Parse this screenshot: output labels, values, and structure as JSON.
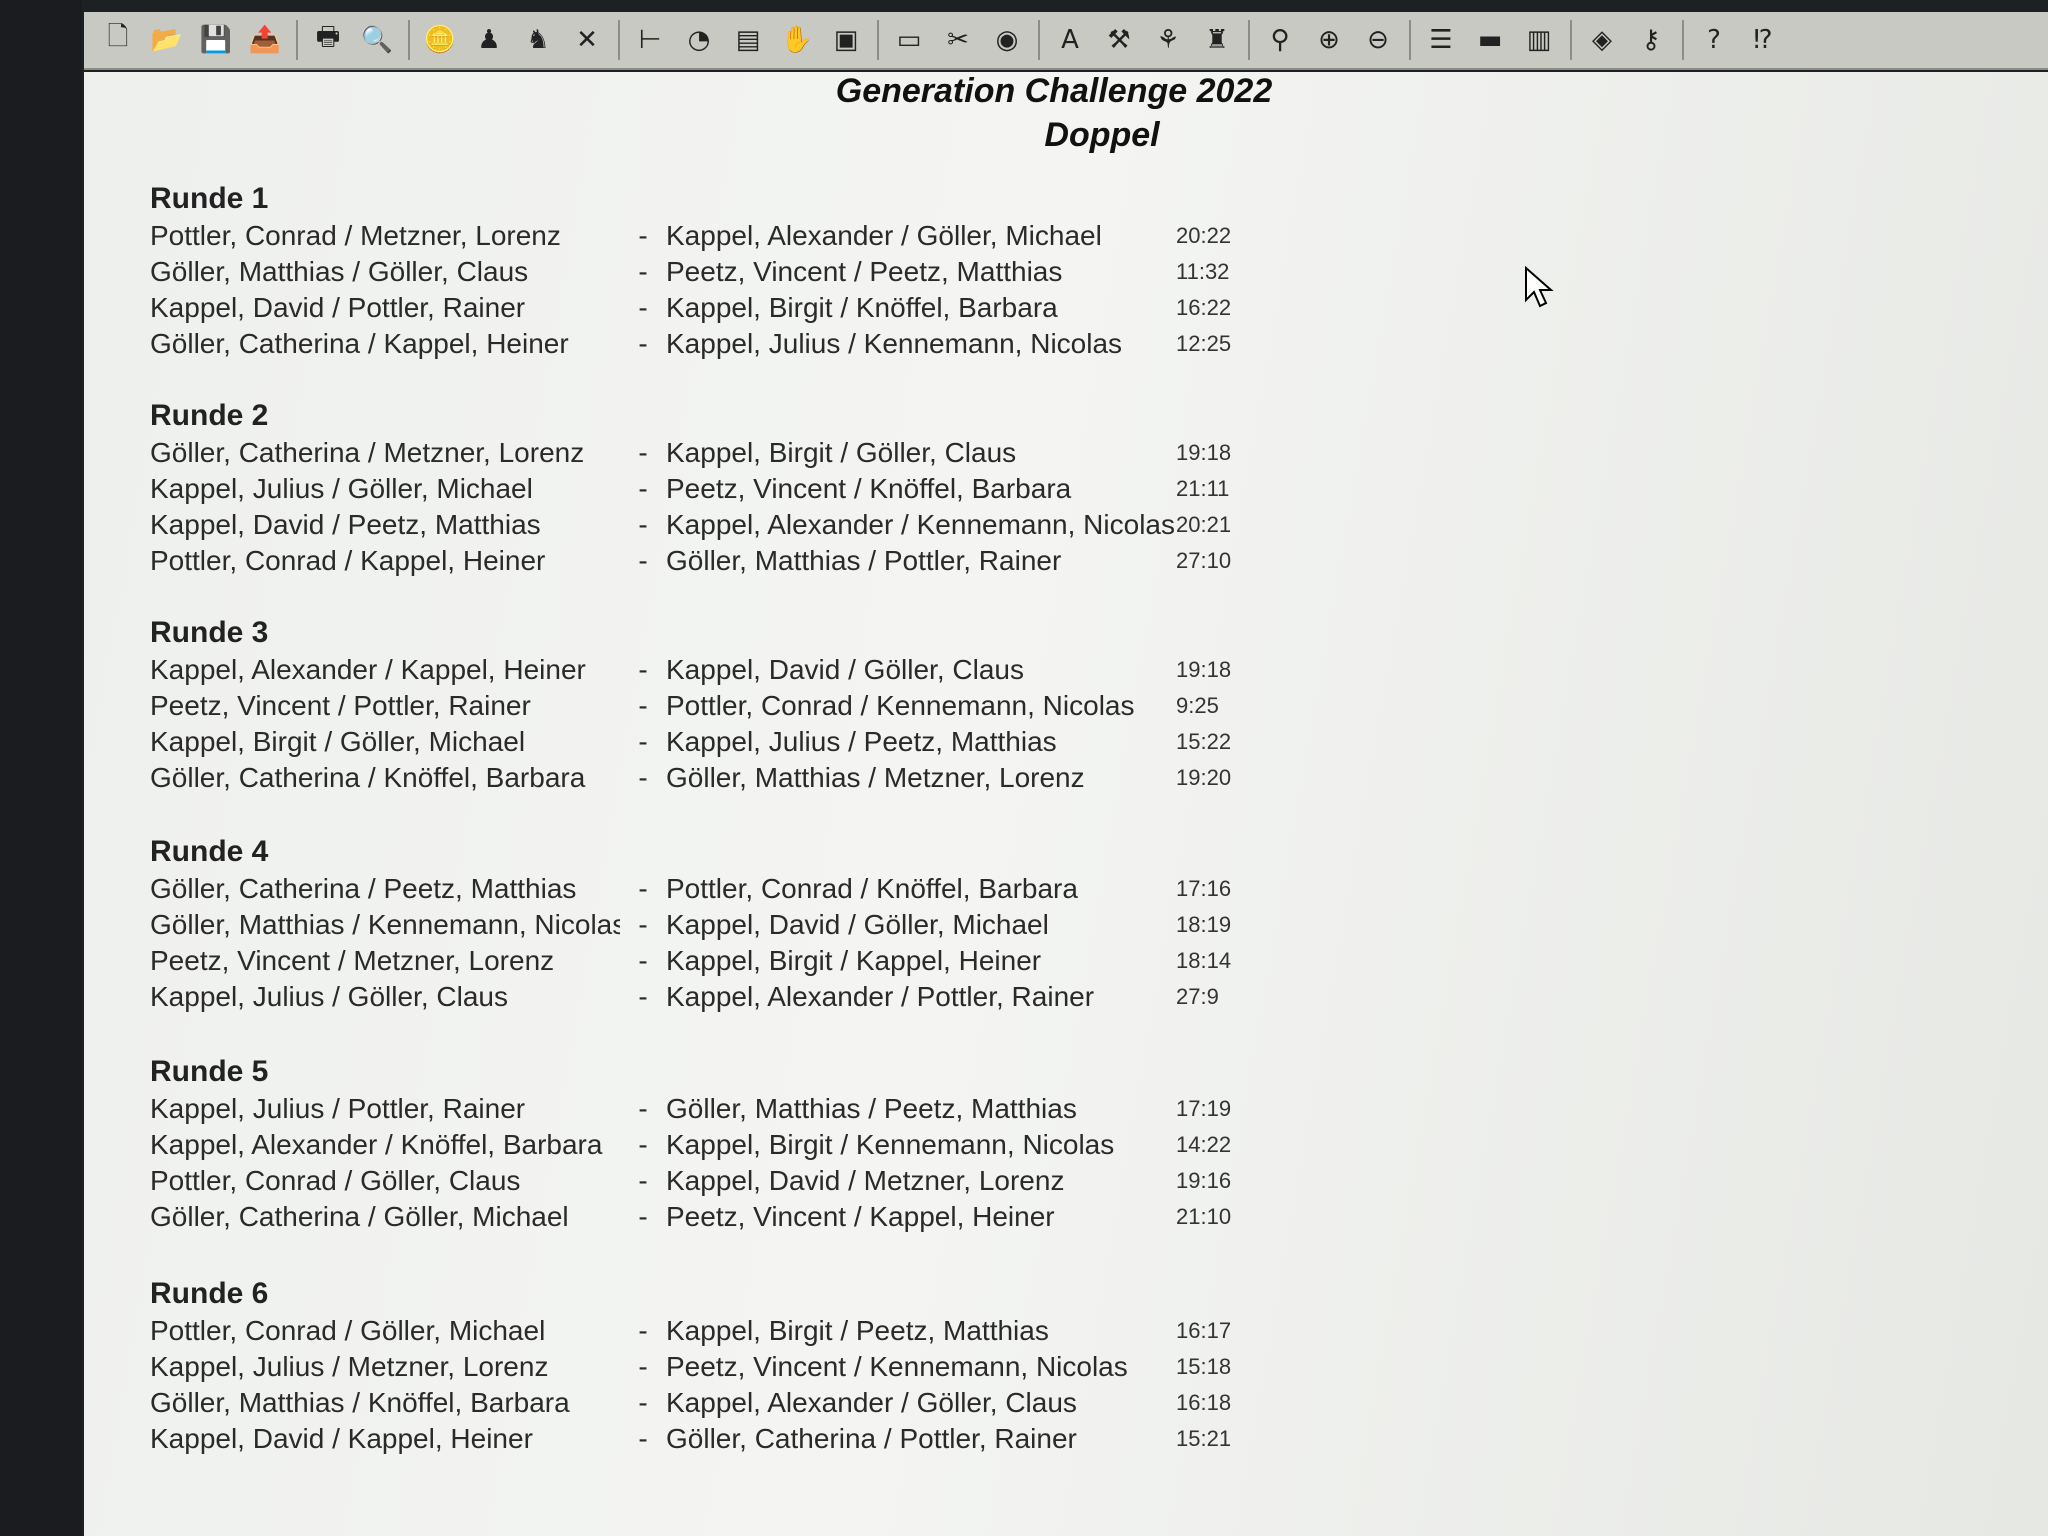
{
  "toolbar": {
    "icons": [
      "new-document-icon",
      "open-folder-icon",
      "save-icon",
      "export-icon",
      "print-icon",
      "print-preview-icon",
      "coin-icon",
      "person-icon",
      "add-person-icon",
      "delete-icon",
      "tree-icon",
      "clock-icon",
      "list-icon",
      "hand-icon",
      "box-icon",
      "card-icon",
      "scissor-icon",
      "globe-icon",
      "text-icon",
      "tools-icon",
      "star-person-icon",
      "group-icon",
      "search-icon",
      "zoom-in-icon",
      "zoom-out-icon",
      "layers-icon",
      "rows-icon",
      "columns-icon",
      "badge-icon",
      "key-icon",
      "help-icon",
      "context-help-icon"
    ],
    "glyphs": [
      "🗋",
      "📂",
      "💾",
      "📤",
      "🖶",
      "🔍",
      "🪙",
      "♟",
      "♞",
      "✕",
      "⊢",
      "◔",
      "▤",
      "✋",
      "▣",
      "▭",
      "✂",
      "◉",
      "A",
      "⚒",
      "⚘",
      "♜",
      "⚲",
      "⊕",
      "⊖",
      "☰",
      "▬",
      "▥",
      "◈",
      "⚷",
      "?",
      "⁉"
    ]
  },
  "header": {
    "title": "Generation Challenge 2022",
    "subtitle": "Doppel"
  },
  "rounds": [
    {
      "title": "Runde 1",
      "matches": [
        {
          "team_a": "Pottler, Conrad / Metzner, Lorenz",
          "team_b": "Kappel, Alexander / Göller, Michael",
          "score": "20:22"
        },
        {
          "team_a": "Göller, Matthias / Göller, Claus",
          "team_b": "Peetz, Vincent / Peetz, Matthias",
          "score": "11:32"
        },
        {
          "team_a": "Kappel, David / Pottler, Rainer",
          "team_b": "Kappel, Birgit / Knöffel, Barbara",
          "score": "16:22"
        },
        {
          "team_a": "Göller, Catherina / Kappel, Heiner",
          "team_b": "Kappel, Julius / Kennemann, Nicolas",
          "score": "12:25"
        }
      ]
    },
    {
      "title": "Runde 2",
      "matches": [
        {
          "team_a": "Göller, Catherina / Metzner, Lorenz",
          "team_b": "Kappel, Birgit / Göller, Claus",
          "score": "19:18"
        },
        {
          "team_a": "Kappel, Julius / Göller, Michael",
          "team_b": "Peetz, Vincent / Knöffel, Barbara",
          "score": "21:11"
        },
        {
          "team_a": "Kappel, David / Peetz, Matthias",
          "team_b": "Kappel, Alexander / Kennemann, Nicolas",
          "score": "20:21"
        },
        {
          "team_a": "Pottler, Conrad / Kappel, Heiner",
          "team_b": "Göller, Matthias / Pottler, Rainer",
          "score": "27:10"
        }
      ]
    },
    {
      "title": "Runde 3",
      "matches": [
        {
          "team_a": "Kappel, Alexander / Kappel, Heiner",
          "team_b": "Kappel, David / Göller, Claus",
          "score": "19:18"
        },
        {
          "team_a": "Peetz, Vincent / Pottler, Rainer",
          "team_b": "Pottler, Conrad / Kennemann, Nicolas",
          "score": "9:25"
        },
        {
          "team_a": "Kappel, Birgit / Göller, Michael",
          "team_b": "Kappel, Julius / Peetz, Matthias",
          "score": "15:22"
        },
        {
          "team_a": "Göller, Catherina / Knöffel, Barbara",
          "team_b": "Göller, Matthias / Metzner, Lorenz",
          "score": "19:20"
        }
      ]
    },
    {
      "title": "Runde 4",
      "matches": [
        {
          "team_a": "Göller, Catherina / Peetz, Matthias",
          "team_b": "Pottler, Conrad / Knöffel, Barbara",
          "score": "17:16"
        },
        {
          "team_a": "Göller, Matthias / Kennemann, Nicolas",
          "team_b": "Kappel, David / Göller, Michael",
          "score": "18:19"
        },
        {
          "team_a": "Peetz, Vincent / Metzner, Lorenz",
          "team_b": "Kappel, Birgit / Kappel, Heiner",
          "score": "18:14"
        },
        {
          "team_a": "Kappel, Julius / Göller, Claus",
          "team_b": "Kappel, Alexander / Pottler, Rainer",
          "score": "27:9"
        }
      ]
    },
    {
      "title": "Runde 5",
      "matches": [
        {
          "team_a": "Kappel, Julius / Pottler, Rainer",
          "team_b": "Göller, Matthias / Peetz, Matthias",
          "score": "17:19"
        },
        {
          "team_a": "Kappel, Alexander / Knöffel, Barbara",
          "team_b": "Kappel, Birgit / Kennemann, Nicolas",
          "score": "14:22"
        },
        {
          "team_a": "Pottler, Conrad / Göller, Claus",
          "team_b": "Kappel, David / Metzner, Lorenz",
          "score": "19:16"
        },
        {
          "team_a": "Göller, Catherina / Göller, Michael",
          "team_b": "Peetz, Vincent / Kappel, Heiner",
          "score": "21:10"
        }
      ]
    },
    {
      "title": "Runde 6",
      "matches": [
        {
          "team_a": "Pottler, Conrad / Göller, Michael",
          "team_b": "Kappel, Birgit / Peetz, Matthias",
          "score": "16:17"
        },
        {
          "team_a": "Kappel, Julius / Metzner, Lorenz",
          "team_b": "Peetz, Vincent / Kennemann, Nicolas",
          "score": "15:18"
        },
        {
          "team_a": "Göller, Matthias / Knöffel, Barbara",
          "team_b": "Kappel, Alexander / Göller, Claus",
          "score": "16:18"
        },
        {
          "team_a": "Kappel, David / Kappel, Heiner",
          "team_b": "Göller, Catherina / Pottler, Rainer",
          "score": "15:21"
        }
      ]
    }
  ],
  "separator": "-"
}
